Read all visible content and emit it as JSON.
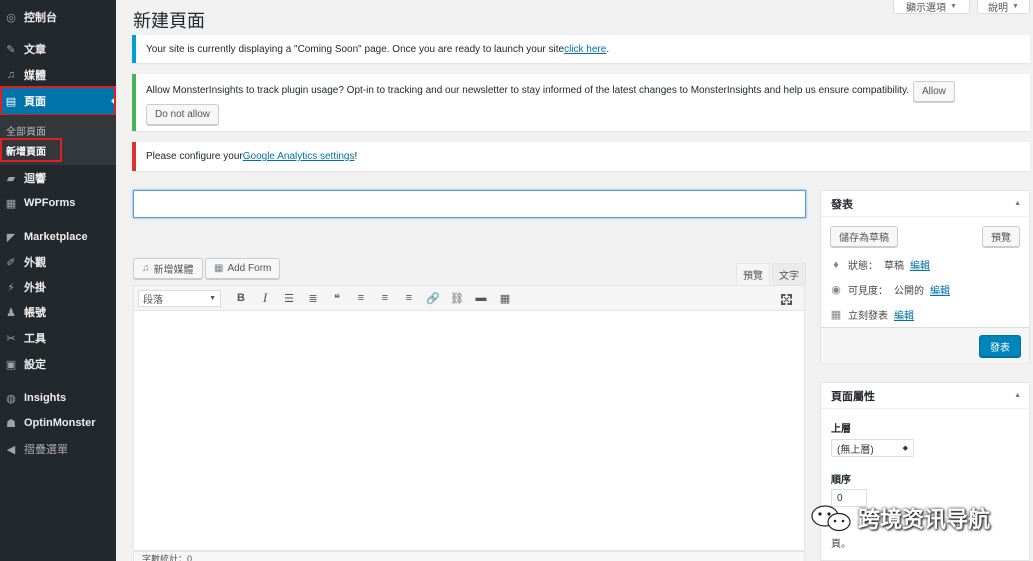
{
  "sidebar": {
    "items": [
      {
        "id": "dashboard",
        "label": "控制台",
        "icon": "dashboard-icon",
        "glyph": "◎"
      },
      {
        "id": "posts",
        "label": "文章",
        "icon": "pin-icon",
        "glyph": "✎"
      },
      {
        "id": "media",
        "label": "媒體",
        "icon": "media-icon",
        "glyph": "♫"
      },
      {
        "id": "pages",
        "label": "頁面",
        "icon": "pages-icon",
        "glyph": "▤"
      },
      {
        "id": "comments",
        "label": "迴響",
        "icon": "comment-icon",
        "glyph": "▰"
      },
      {
        "id": "wpforms",
        "label": "WPForms",
        "icon": "form-icon",
        "glyph": "▦"
      },
      {
        "id": "marketplace",
        "label": "Marketplace",
        "icon": "marketplace-icon",
        "glyph": "◤"
      },
      {
        "id": "appearance",
        "label": "外觀",
        "icon": "brush-icon",
        "glyph": "✐"
      },
      {
        "id": "plugins",
        "label": "外掛",
        "icon": "plugin-icon",
        "glyph": "⚡"
      },
      {
        "id": "users",
        "label": "帳號",
        "icon": "user-icon",
        "glyph": "♟"
      },
      {
        "id": "tools",
        "label": "工具",
        "icon": "wrench-icon",
        "glyph": "✂"
      },
      {
        "id": "settings",
        "label": "設定",
        "icon": "settings-icon",
        "glyph": "▣"
      },
      {
        "id": "insights",
        "label": "Insights",
        "icon": "insights-icon",
        "glyph": "◍"
      },
      {
        "id": "optinmonster",
        "label": "OptinMonster",
        "icon": "monster-icon",
        "glyph": "☗"
      },
      {
        "id": "collapse",
        "label": "摺疊選單",
        "icon": "collapse-icon",
        "glyph": "◀"
      }
    ],
    "submenu": [
      "全部頁面",
      "新增頁面"
    ]
  },
  "header": {
    "title": "新建頁面",
    "screen_options": "顯示選項",
    "help": "說明"
  },
  "notices": {
    "coming_soon_text": "Your site is currently displaying a \"Coming Soon\" page. Once you are ready to launch your site ",
    "coming_soon_link": "click here",
    "coming_soon_end": ".",
    "monster_text": "Allow MonsterInsights to track plugin usage? Opt-in to tracking and our newsletter to stay informed of the latest changes to MonsterInsights and help us ensure compatibility.",
    "monster_allow": "Allow",
    "monster_deny": "Do not allow",
    "ga_text": "Please configure your ",
    "ga_link": "Google Analytics settings",
    "ga_end": "!"
  },
  "editor": {
    "title_value": "",
    "add_media": "新增媒體",
    "add_form": "Add Form",
    "tab_visual": "預覽",
    "tab_text": "文字",
    "format_select": "段落",
    "word_count": "字數統計：0",
    "toolbar_icons": [
      {
        "name": "bold-icon",
        "glyph": "B"
      },
      {
        "name": "italic-icon",
        "glyph": "I"
      },
      {
        "name": "bullet-list-icon",
        "glyph": "☰"
      },
      {
        "name": "numbered-list-icon",
        "glyph": "≣"
      },
      {
        "name": "blockquote-icon",
        "glyph": "❝"
      },
      {
        "name": "align-left-icon",
        "glyph": "≡"
      },
      {
        "name": "align-center-icon",
        "glyph": "≡"
      },
      {
        "name": "align-right-icon",
        "glyph": "≡"
      },
      {
        "name": "link-icon",
        "glyph": "🔗"
      },
      {
        "name": "unlink-icon",
        "glyph": "⛓"
      },
      {
        "name": "read-more-icon",
        "glyph": "▬"
      },
      {
        "name": "toolbar-toggle-icon",
        "glyph": "▦"
      }
    ]
  },
  "publish": {
    "title": "發表",
    "save_draft": "儲存為草稿",
    "preview": "預覽",
    "status_label": "狀態：",
    "status_value": "草稿",
    "visibility_label": "可見度：",
    "visibility_value": "公開的",
    "schedule_label": "立刻發表",
    "edit": "編輯",
    "publish_btn": "發表"
  },
  "attributes": {
    "title": "頁面屬性",
    "parent_label": "上層",
    "parent_value": "(無上層)",
    "order_label": "順序",
    "order_value": "0",
    "help_tail": "頁。"
  },
  "watermark": "跨境资讯导航"
}
